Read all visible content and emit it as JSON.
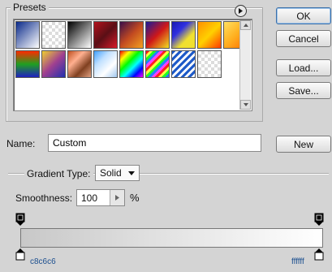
{
  "presets": {
    "title": "Presets",
    "flyout_icon": "right-arrow-circle-icon",
    "swatches": [
      "linear-gradient(135deg,#0a2a8a,#ffffff)",
      "repeating-conic-gradient(#dcdcdc 0 25%,#ffffff 0 50%) 0 0/8px 8px",
      "linear-gradient(135deg,#000000,#ffffff)",
      "linear-gradient(135deg,#b3121c,#5a0f16,#d81b2a)",
      "linear-gradient(135deg,#3a0d4a,#c24a20,#f4a020)",
      "linear-gradient(135deg,#1a1a9a,#d01818,#f0e020)",
      "linear-gradient(135deg,#1818b0,#3030e0,#f0e030,#f0e030)",
      "linear-gradient(135deg,#ff9000,#ffd000,#ff3a00)",
      "linear-gradient(135deg,#ffe060,#ffb020,#ff7000)",
      "linear-gradient(to bottom,#ff2a00,#20a020,#2020c0)",
      "linear-gradient(135deg,#f0d030,#a04090,#2030b0)",
      "linear-gradient(135deg,#c05020,#ffb090,#804020,#e0a080)",
      "linear-gradient(135deg,#40a0ff,#c0e0ff,#ffffff,#a0c8f0)",
      "linear-gradient(135deg,#ff0000,#ffff00,#00ff00,#00ffff,#0000ff,#ff00ff)",
      "repeating-linear-gradient(135deg,#ff2020 0 3px,#ffff40 3px 6px,#20ff20 6px 9px,#2080ff 9px 12px,#ff40ff 12px 15px)",
      "repeating-linear-gradient(135deg,#1e5ac8 0 3px,#ffffff 3px 6px)",
      "repeating-conic-gradient(#dcdcdc 0 25%,#ffffff 0 50%) 0 0/8px 8px"
    ]
  },
  "buttons": {
    "ok": "OK",
    "cancel": "Cancel",
    "load": "Load...",
    "save": "Save...",
    "new": "New"
  },
  "name": {
    "label": "Name:",
    "value": "Custom"
  },
  "gradient_type": {
    "label": "Gradient Type:",
    "value": "Solid"
  },
  "smoothness": {
    "label": "Smoothness:",
    "value": "100",
    "unit": "%"
  },
  "gradient": {
    "left_color": "c8c6c6",
    "right_color": "ffffff"
  }
}
